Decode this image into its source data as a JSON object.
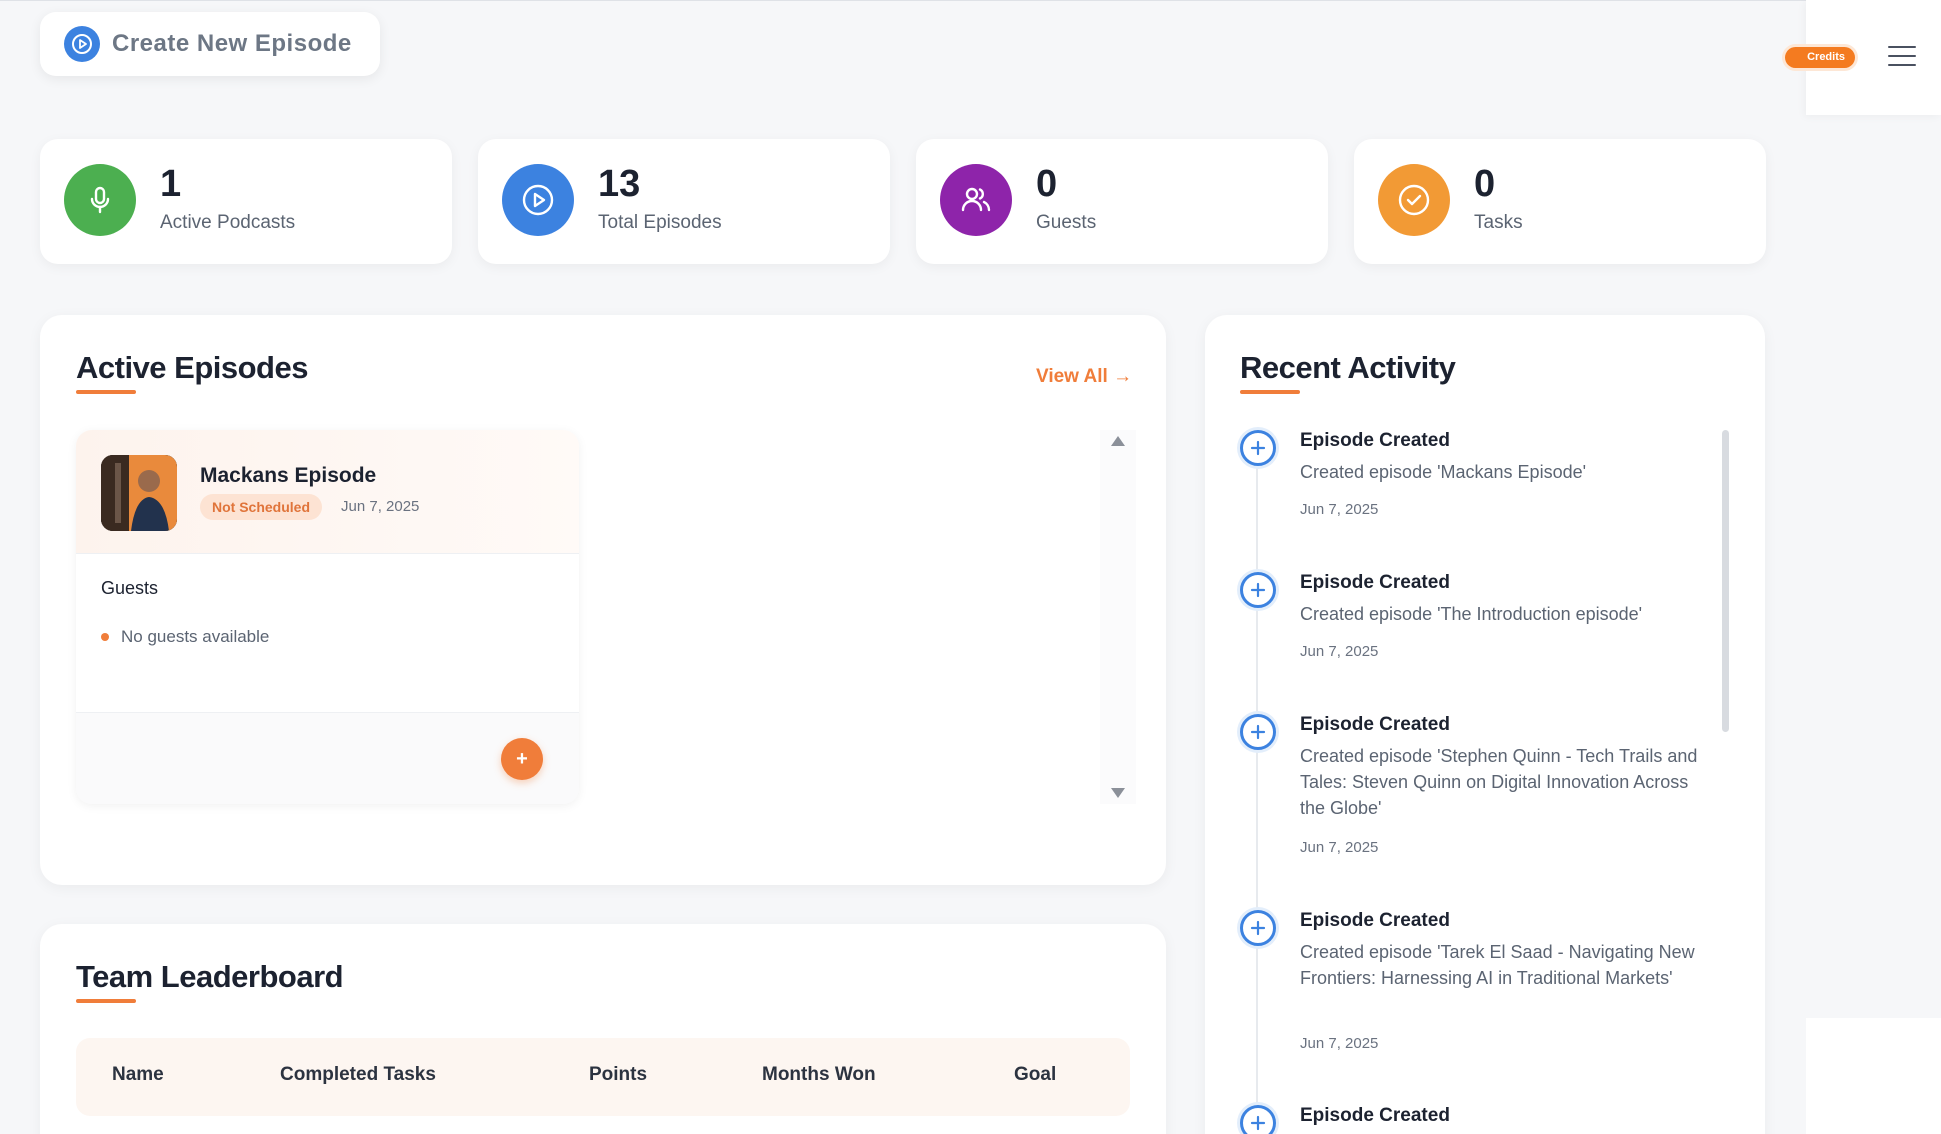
{
  "header": {
    "create_label": "Create New Episode",
    "credits_label": "Credits"
  },
  "stats": [
    {
      "value": "1",
      "label": "Active Podcasts",
      "color": "#4caf50",
      "icon": "microphone-icon"
    },
    {
      "value": "13",
      "label": "Total Episodes",
      "color": "#3c82e0",
      "icon": "play-icon"
    },
    {
      "value": "0",
      "label": "Guests",
      "color": "#8e24aa",
      "icon": "users-icon"
    },
    {
      "value": "0",
      "label": "Tasks",
      "color": "#f29a35",
      "icon": "check-circle-icon"
    }
  ],
  "active_episodes": {
    "title": "Active Episodes",
    "view_all": "View All →",
    "episode": {
      "title": "Mackans Episode",
      "status": "Not Scheduled",
      "date": "Jun 7, 2025",
      "guests_heading": "Guests",
      "no_guests": "No guests available",
      "add_label": "+"
    }
  },
  "leaderboard": {
    "title": "Team Leaderboard",
    "columns": [
      "Name",
      "Completed Tasks",
      "Points",
      "Months Won",
      "Goal"
    ]
  },
  "recent_activity": {
    "title": "Recent Activity",
    "items": [
      {
        "title": "Episode Created",
        "desc": "Created episode 'Mackans Episode'",
        "date": "Jun 7, 2025"
      },
      {
        "title": "Episode Created",
        "desc": "Created episode 'The Introduction episode'",
        "date": "Jun 7, 2025"
      },
      {
        "title": "Episode Created",
        "desc": "Created episode 'Stephen Quinn - Tech Trails and Tales: Steven Quinn on Digital Innovation Across the Globe'",
        "date": "Jun 7, 2025"
      },
      {
        "title": "Episode Created",
        "desc": "Created episode 'Tarek El Saad - Navigating New Frontiers: Harnessing AI in Traditional Markets'",
        "date": "Jun 7, 2025"
      },
      {
        "title": "Episode Created"
      }
    ]
  },
  "colors": {
    "accent": "#f07d3a",
    "brand_blue": "#3c82e0"
  }
}
